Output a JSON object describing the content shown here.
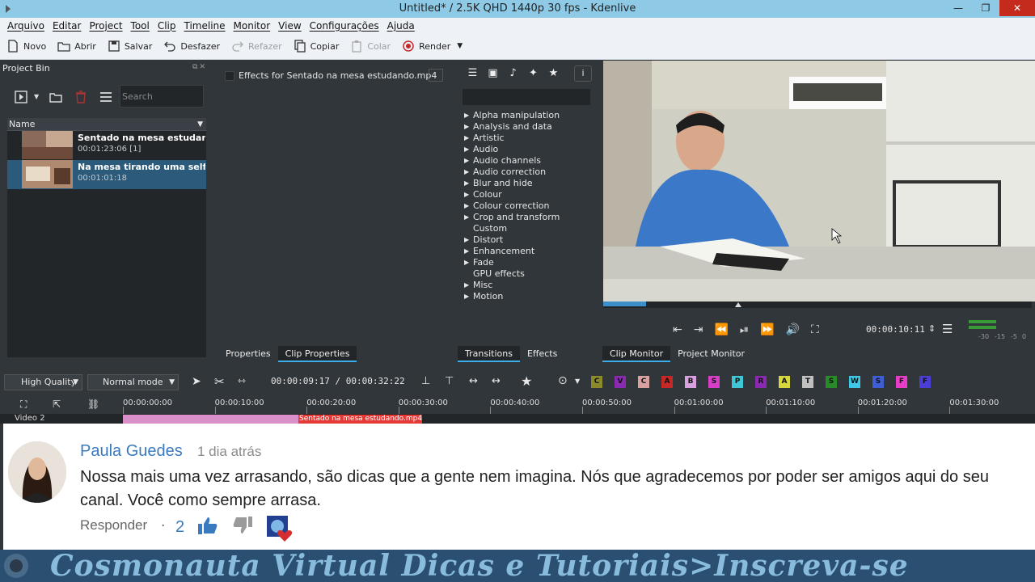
{
  "window": {
    "title": "Untitled* / 2.5K QHD 1440p 30 fps - Kdenlive",
    "min": "—",
    "max": "❐",
    "close": "✕"
  },
  "menu": [
    "Arquivo",
    "Editar",
    "Project",
    "Tool",
    "Clip",
    "Timeline",
    "Monitor",
    "View",
    "Configurações",
    "Ajuda"
  ],
  "toolbar": {
    "novo": "Novo",
    "abrir": "Abrir",
    "salvar": "Salvar",
    "desfazer": "Desfazer",
    "refazer": "Refazer",
    "copiar": "Copiar",
    "colar": "Colar",
    "render": "Render"
  },
  "project_bin": {
    "title": "Project Bin",
    "search_placeholder": "Search",
    "column": "Name",
    "items": [
      {
        "name": "Sentado na mesa estudando.m",
        "duration": "00:01:23:06  [1]"
      },
      {
        "name": "Na mesa tirando uma selfie cor",
        "duration": "00:01:01:18"
      }
    ]
  },
  "effect_props": {
    "header": "Effects for Sentado na mesa estudando.mp4"
  },
  "effects": {
    "categories": [
      {
        "label": "Alpha manipulation",
        "expandable": true
      },
      {
        "label": "Analysis and data",
        "expandable": true
      },
      {
        "label": "Artistic",
        "expandable": true
      },
      {
        "label": "Audio",
        "expandable": true
      },
      {
        "label": "Audio channels",
        "expandable": true
      },
      {
        "label": "Audio correction",
        "expandable": true
      },
      {
        "label": "Blur and hide",
        "expandable": true
      },
      {
        "label": "Colour",
        "expandable": true
      },
      {
        "label": "Colour correction",
        "expandable": true
      },
      {
        "label": "Crop and transform",
        "expandable": true
      },
      {
        "label": "Custom",
        "expandable": false
      },
      {
        "label": "Distort",
        "expandable": true
      },
      {
        "label": "Enhancement",
        "expandable": true
      },
      {
        "label": "Fade",
        "expandable": true
      },
      {
        "label": "GPU effects",
        "expandable": false
      },
      {
        "label": "Misc",
        "expandable": true
      },
      {
        "label": "Motion",
        "expandable": true
      }
    ]
  },
  "monitor": {
    "timecode": "00:00:10:11",
    "vu_labels": [
      "-30",
      "-15",
      "-5",
      "0"
    ],
    "seek_progress": 0.1
  },
  "tabs": {
    "properties": "Properties",
    "clip_properties": "Clip Properties",
    "transitions": "Transitions",
    "effects": "Effects",
    "clip_monitor": "Clip Monitor",
    "project_monitor": "Project Monitor"
  },
  "timeline": {
    "quality": "High Quality",
    "mode": "Normal mode",
    "timecode": "00:00:09:17 / 00:00:32:22",
    "ruler": [
      "00:00:00:00",
      "00:00:10:00",
      "00:00:20:00",
      "00:00:30:00",
      "00:00:40:00",
      "00:00:50:00",
      "00:01:00:00",
      "00:01:10:00",
      "00:01:20:00",
      "00:01:30:00"
    ],
    "track_label": "Video 2",
    "clip_label": "Sentado na mesa estudando.mp4",
    "effect_buttons": [
      {
        "letter": "C",
        "color": "#8a8a2a"
      },
      {
        "letter": "V",
        "color": "#8a2ab0"
      },
      {
        "letter": "C",
        "color": "#d9a0a0"
      },
      {
        "letter": "A",
        "color": "#c62828"
      },
      {
        "letter": "B",
        "color": "#d9a0e0"
      },
      {
        "letter": "S",
        "color": "#d63ec7"
      },
      {
        "letter": "P",
        "color": "#3ec7d6"
      },
      {
        "letter": "R",
        "color": "#8a2ab0"
      },
      {
        "letter": "A",
        "color": "#d6d63e"
      },
      {
        "letter": "T",
        "color": "#c0c0c0"
      },
      {
        "letter": "S",
        "color": "#2a8a2a"
      },
      {
        "letter": "W",
        "color": "#3ec7e6"
      },
      {
        "letter": "S",
        "color": "#3e5ed6"
      },
      {
        "letter": "F",
        "color": "#e63ec7"
      },
      {
        "letter": "F",
        "color": "#4a3ed6"
      }
    ]
  },
  "comment": {
    "author": "Paula Guedes",
    "when": "1 dia atrás",
    "text": "Nossa mais uma vez arrasando, são dicas que a gente nem imagina. Nós que agradecemos por poder ser amigos aqui do seu canal. Você como sempre arrasa.",
    "reply": "Responder",
    "separator": "·",
    "likes": "2"
  },
  "banner": {
    "text": "Cosmonauta Virtual Dicas e Tutoriais>Inscreva-se"
  },
  "colors": {
    "accent": "#3daee9",
    "panel": "#31363b",
    "link": "#3a7bbf",
    "clip": "#d98fc7",
    "clip_red": "#e53935"
  }
}
